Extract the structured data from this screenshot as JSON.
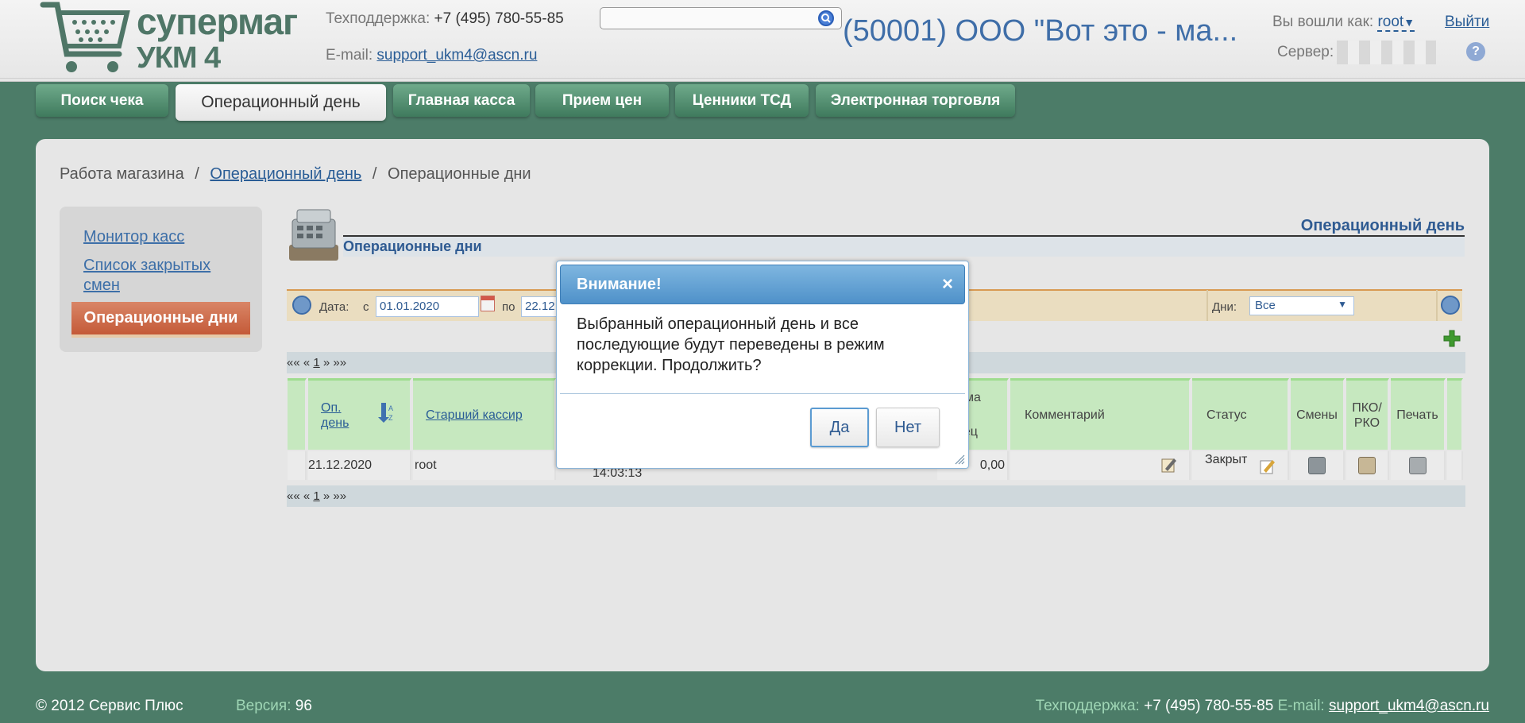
{
  "header": {
    "logo_line1": "супермаг",
    "logo_line2": "УКМ 4",
    "support_label": "Техподдержка:",
    "support_phone": "+7 (495) 780-55-85",
    "email_label": "E-mail:",
    "email": "support_ukm4@ascn.ru",
    "search_placeholder": "",
    "store_title": "(50001) ООО \"Вот это - ма...",
    "logged_as_label": "Вы вошли как:",
    "user": "root",
    "logout": "Выйти",
    "server_label": "Сервер:",
    "help_icon": "?"
  },
  "tabs": [
    {
      "label": "Поиск чека"
    },
    {
      "label": "Операционный день",
      "active": true
    },
    {
      "label": "Главная касса"
    },
    {
      "label": "Прием цен"
    },
    {
      "label": "Ценники ТСД"
    },
    {
      "label": "Электронная торговля"
    }
  ],
  "breadcrumb": {
    "root": "Работа магазина",
    "sep": "/",
    "link": "Операционный день",
    "current": "Операционные дни"
  },
  "sidebar": {
    "items": [
      {
        "label": "Монитор касс"
      },
      {
        "label": "Список закрытых смен"
      },
      {
        "label": "Операционные дни",
        "active": true
      }
    ]
  },
  "content": {
    "section_right_title": "Операционный день",
    "section_title": "Операционные дни",
    "filter": {
      "date_label": "Дата:",
      "from_label": "с",
      "from_value": "01.01.2020",
      "to_label": "по",
      "to_value": "22.12",
      "days_label": "Дни:",
      "days_value": "Все"
    },
    "pager": {
      "first": "««",
      "prev": "«",
      "page": "1",
      "next": "»",
      "last": "»»"
    },
    "columns": {
      "opday_line1": "Оп.",
      "opday_line2": "день",
      "senior_cashier": "Старший кассир",
      "sum_partial1": "мма",
      "sum_partial2": "нец",
      "comment": "Комментарий",
      "status": "Статус",
      "shifts": "Смены",
      "pko_line1": "ПКО/",
      "pko_line2": "РКО",
      "print": "Печать"
    },
    "row": {
      "opday": "21.12.2020",
      "cashier": "root",
      "time": "14:03:13",
      "user_partial": "root",
      "sum_partial": "0,00",
      "sum_end": "0,00",
      "status": "Закрыт"
    }
  },
  "dialog": {
    "title": "Внимание!",
    "close": "×",
    "message": "Выбранный операционный день и все последующие будут переведены в режим коррекции. Продолжить?",
    "yes": "Да",
    "no": "Нет"
  },
  "footer": {
    "copyright": "© 2012 Сервис Плюс",
    "version_label": "Версия:",
    "version": "96",
    "support_label": "Техподдержка:",
    "support_phone": "+7 (495) 780-55-85",
    "email_label": "E-mail:",
    "email": "support_ukm4@ascn.ru"
  },
  "colors": {
    "background": "#4c7c68",
    "tab": "#5a9474",
    "active_menu": "#c9643f",
    "link": "#2a5d96",
    "dialog_title": "#5b9bd2"
  }
}
